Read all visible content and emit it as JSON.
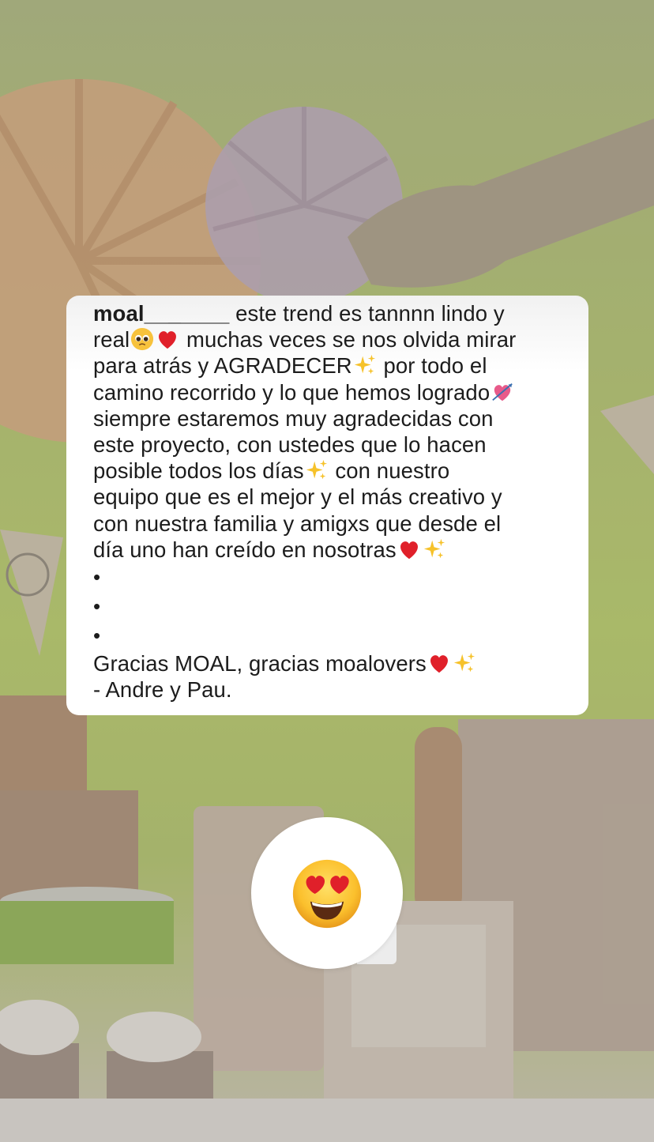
{
  "comment": {
    "username": "moal_______",
    "lines": [
      " este trend es tannnn lindo y",
      "real",
      " muchas veces se nos olvida mirar",
      "para atrás y AGRADECER",
      " por todo el",
      "camino recorrido y lo que hemos logrado",
      "siempre estaremos muy agradecidas con",
      "este proyecto, con ustedes que lo hacen",
      "posible todos los días",
      " con nuestro",
      "equipo que es el mejor y el más creativo y",
      "con nuestra familia y amigxs que desde el",
      "día uno han creído en nosotras",
      "Gracias MOAL, gracias moalovers",
      "- Andre y Pau."
    ],
    "bullets": [
      "•",
      "•",
      "•"
    ]
  },
  "reaction": {
    "emoji": "heart-eyes-emoji"
  },
  "colors": {
    "heart": "#e0202a",
    "sparkle": "#f6c22b",
    "text": "#1c1c1c",
    "card": "#ffffff"
  }
}
